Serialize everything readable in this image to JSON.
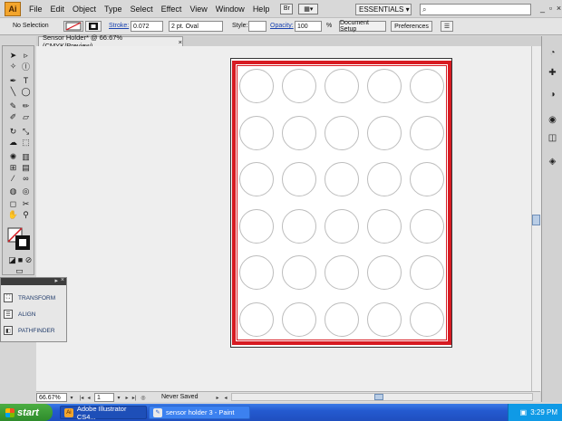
{
  "menubar": {
    "logo": "Ai",
    "items": [
      "File",
      "Edit",
      "Object",
      "Type",
      "Select",
      "Effect",
      "View",
      "Window",
      "Help"
    ],
    "bridge_icon": "Br",
    "arrange_icon": "▦▾",
    "workspace": "ESSENTIALS ▾",
    "search_placeholder": "",
    "window_controls": [
      "_",
      "▫",
      "×"
    ]
  },
  "controlbar": {
    "selection": "No Selection",
    "stroke_label": "Stroke:",
    "stroke_value": "0.072",
    "brush_value": "2 pt. Oval",
    "style_label": "Style:",
    "opacity_label": "Opacity:",
    "opacity_value": "100",
    "percent": "%",
    "document_setup": "Document Setup",
    "preferences": "Preferences"
  },
  "document": {
    "tab_title": "Sensor Holder* @ 66.67% (CMYK/Preview)",
    "tab_close": "×"
  },
  "artboard": {
    "rows": 6,
    "cols": 5,
    "frame_color": "#d71b22"
  },
  "statusbar": {
    "zoom": "66.67%",
    "artboard_index": "1",
    "status": "Never Saved"
  },
  "tools_icons": [
    "selection-icon",
    "direct-selection-icon",
    "magic-wand-icon",
    "lasso-icon",
    "pen-icon",
    "type-icon",
    "line-icon",
    "ellipse-icon",
    "paintbrush-icon",
    "pencil-icon",
    "blob-brush-icon",
    "eraser-icon",
    "rotate-icon",
    "scale-icon",
    "warp-icon",
    "free-transform-icon",
    "symbol-sprayer-icon",
    "graph-icon",
    "mesh-icon",
    "gradient-icon",
    "eyedropper-icon",
    "blend-icon",
    "live-paint-icon",
    "live-paint-select-icon",
    "artboard-icon",
    "slice-icon",
    "hand-icon",
    "zoom-icon"
  ],
  "panels": [
    {
      "label": "TRANSFORM",
      "icon": "transform-icon"
    },
    {
      "label": "ALIGN",
      "icon": "align-icon"
    },
    {
      "label": "PATHFINDER",
      "icon": "pathfinder-icon"
    }
  ],
  "taskbar": {
    "start": "start",
    "tasks": [
      {
        "label": "Adobe Illustrator CS4...",
        "icon": "Ai"
      },
      {
        "label": "sensor holder 3 - Paint",
        "icon": "✎"
      }
    ],
    "clock": "3:29 PM"
  }
}
